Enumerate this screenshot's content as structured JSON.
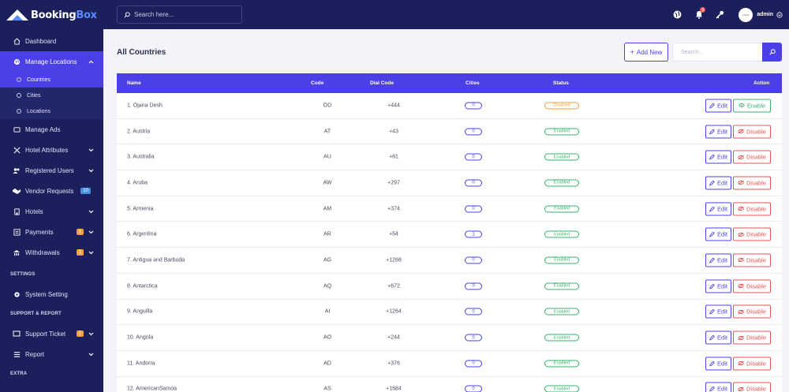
{
  "brand": {
    "name_part1": "Booking",
    "name_part2": "Box"
  },
  "topbar": {
    "search_placeholder": "Search here...",
    "notification_count": "6",
    "avatar_text": "LOGO",
    "user_name": "admin"
  },
  "sidebar": {
    "items": [
      {
        "label": "Dashboard",
        "icon": "home-icon"
      },
      {
        "label": "Manage Locations",
        "icon": "globe-icon",
        "active": true
      },
      {
        "label": "Manage Ads",
        "icon": "ads-icon"
      },
      {
        "label": "Hotel Attributes",
        "icon": "tools-icon"
      },
      {
        "label": "Registered Users",
        "icon": "users-icon"
      },
      {
        "label": "Vendor Requests",
        "icon": "handshake-icon",
        "badge": "10"
      },
      {
        "label": "Hotels",
        "icon": "hotel-icon"
      },
      {
        "label": "Payments",
        "icon": "payments-icon",
        "badge": "1"
      },
      {
        "label": "Withdrawals",
        "icon": "withdraw-icon",
        "badge": "1"
      },
      {
        "label": "System Setting",
        "icon": "gear-icon"
      },
      {
        "label": "Support Ticket",
        "icon": "ticket-icon",
        "badge": "1"
      },
      {
        "label": "Report",
        "icon": "report-icon"
      }
    ],
    "sub_items": [
      {
        "label": "Countries"
      },
      {
        "label": "Cities"
      },
      {
        "label": "Locations"
      }
    ],
    "sections": {
      "settings": "SETTINGS",
      "support": "SUPPORT & REPORT",
      "extra": "EXTRA"
    }
  },
  "page": {
    "title": "All Countries",
    "add_new_label": "Add New",
    "search_placeholder": "Search..."
  },
  "table": {
    "headers": {
      "name": "Name",
      "code": "Code",
      "dial": "Dial Code",
      "cities": "Cities",
      "status": "Status",
      "action": "Action"
    },
    "edit_label": "Edit",
    "rows": [
      {
        "name": "1.  Ojana Desh",
        "code": "OD",
        "dial": "+444",
        "cities": "0",
        "status": "Disabled",
        "action": "Enable"
      },
      {
        "name": "2.  Austria",
        "code": "AT",
        "dial": "+43",
        "cities": "0",
        "status": "Enabled",
        "action": "Disable"
      },
      {
        "name": "3.  Australia",
        "code": "AU",
        "dial": "+61",
        "cities": "0",
        "status": "Enabled",
        "action": "Disable"
      },
      {
        "name": "4.  Aruba",
        "code": "AW",
        "dial": "+297",
        "cities": "0",
        "status": "Enabled",
        "action": "Disable"
      },
      {
        "name": "5.  Armenia",
        "code": "AM",
        "dial": "+374",
        "cities": "0",
        "status": "Enabled",
        "action": "Disable"
      },
      {
        "name": "6.  Argentina",
        "code": "AR",
        "dial": "+54",
        "cities": "1",
        "status": "Enabled",
        "action": "Disable"
      },
      {
        "name": "7.  Antigua and Barbuda",
        "code": "AG",
        "dial": "+1268",
        "cities": "0",
        "status": "Enabled",
        "action": "Disable"
      },
      {
        "name": "8.  Antarctica",
        "code": "AQ",
        "dial": "+672",
        "cities": "0",
        "status": "Enabled",
        "action": "Disable"
      },
      {
        "name": "9.  Anguilla",
        "code": "AI",
        "dial": "+1264",
        "cities": "0",
        "status": "Enabled",
        "action": "Disable"
      },
      {
        "name": "10.  Angola",
        "code": "AO",
        "dial": "+244",
        "cities": "0",
        "status": "Enabled",
        "action": "Disable"
      },
      {
        "name": "11.  Andorra",
        "code": "AD",
        "dial": "+376",
        "cities": "0",
        "status": "Enabled",
        "action": "Disable"
      },
      {
        "name": "12.  AmericanSamoa",
        "code": "AS",
        "dial": "+1684",
        "cities": "0",
        "status": "Enabled",
        "action": "Disable"
      }
    ]
  },
  "colors": {
    "primary": "#4b3fe6",
    "sidebar": "#1b1f5c",
    "success": "#34b36b",
    "danger": "#e05454",
    "warning": "#f0a140"
  }
}
